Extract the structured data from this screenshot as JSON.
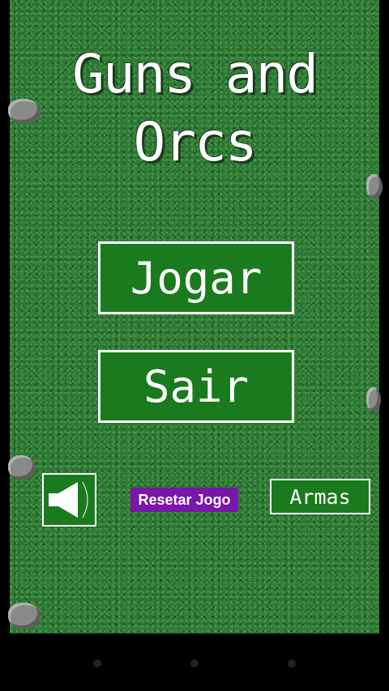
{
  "game": {
    "title_line1": "Guns and",
    "title_line2": "Orcs"
  },
  "menu": {
    "play_label": "Jogar",
    "exit_label": "Sair"
  },
  "footer": {
    "sound_icon": "speaker-icon",
    "reset_label": "Resetar Jogo",
    "weapons_label": "Armas"
  },
  "colors": {
    "grass": "#2f7a35",
    "button_green": "#1a7a1e",
    "reset_purple": "#7a16a8",
    "border": "#ffffff"
  },
  "system_nav": {
    "buttons": [
      "back",
      "home",
      "recents"
    ]
  }
}
